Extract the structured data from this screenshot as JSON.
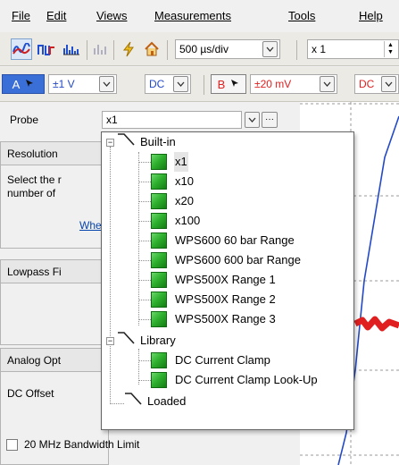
{
  "menu": {
    "file": "File",
    "edit": "Edit",
    "views": "Views",
    "measurements": "Measurements",
    "tools": "Tools",
    "help": "Help"
  },
  "toolbar": {
    "timebase": "500 µs/div",
    "zoom": "x 1",
    "channel_a": {
      "label": "A",
      "range": "±1 V",
      "coupling": "DC",
      "color": "#3b6fd8"
    },
    "channel_b": {
      "label": "B",
      "range": "±20 mV",
      "coupling": "DC",
      "color": "#e03030"
    }
  },
  "panel": {
    "probe_label": "Probe",
    "probe_value": "x1",
    "resolution_title": "Resolution",
    "resolution_text_1": "Select the r",
    "resolution_text_2": "number of",
    "resolution_link": "Whe",
    "lowpass_title": "Lowpass Fi",
    "analog_title": "Analog Opt",
    "dc_offset_label": "DC Offset",
    "bandwidth_label": "20 MHz Bandwidth Limit"
  },
  "tree": {
    "builtin": {
      "label": "Built-in",
      "items": [
        "x1",
        "x10",
        "x20",
        "x100",
        "WPS600 60 bar Range",
        "WPS600 600 bar Range",
        "WPS500X Range 1",
        "WPS500X Range 2",
        "WPS500X Range 3"
      ]
    },
    "library": {
      "label": "Library",
      "items": [
        "DC Current Clamp",
        "DC Current Clamp Look-Up"
      ]
    },
    "loaded": {
      "label": "Loaded"
    },
    "selected": "x1"
  },
  "colors": {
    "trace_blue": "#2349c6",
    "trace_red": "#e02020",
    "leaf_green": "#2fb12f"
  }
}
